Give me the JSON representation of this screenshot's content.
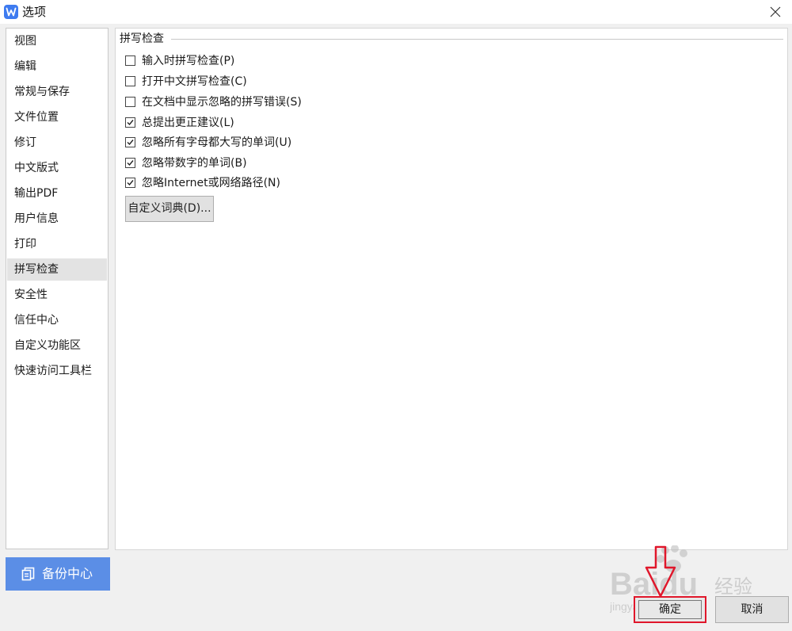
{
  "window": {
    "title": "选项",
    "app_logo_color": "#3e7bf0"
  },
  "sidebar": {
    "items": [
      {
        "label": "视图"
      },
      {
        "label": "编辑"
      },
      {
        "label": "常规与保存"
      },
      {
        "label": "文件位置"
      },
      {
        "label": "修订"
      },
      {
        "label": "中文版式"
      },
      {
        "label": "输出PDF"
      },
      {
        "label": "用户信息"
      },
      {
        "label": "打印"
      },
      {
        "label": "拼写检查",
        "selected": true
      },
      {
        "label": "安全性"
      },
      {
        "label": "信任中心"
      },
      {
        "label": "自定义功能区"
      },
      {
        "label": "快速访问工具栏"
      }
    ],
    "backup_label": "备份中心",
    "backup_color": "#5b8ee6"
  },
  "content": {
    "section_title": "拼写检查",
    "options": [
      {
        "label": "输入时拼写检查(P)",
        "checked": false
      },
      {
        "label": "打开中文拼写检查(C)",
        "checked": false
      },
      {
        "label": "在文档中显示忽略的拼写错误(S)",
        "checked": false
      },
      {
        "label": "总提出更正建议(L)",
        "checked": true
      },
      {
        "label": "忽略所有字母都大写的单词(U)",
        "checked": true
      },
      {
        "label": "忽略带数字的单词(B)",
        "checked": true
      },
      {
        "label": "忽略Internet或网络路径(N)",
        "checked": true
      }
    ],
    "custom_dict_label": "自定义词典(D)..."
  },
  "footer": {
    "ok_label": "确定",
    "cancel_label": "取消",
    "highlight_color": "#e0172b"
  },
  "watermark": {
    "brand": "Baidu",
    "brand_cn": "经验",
    "url": "jingyan.baidu.com"
  }
}
